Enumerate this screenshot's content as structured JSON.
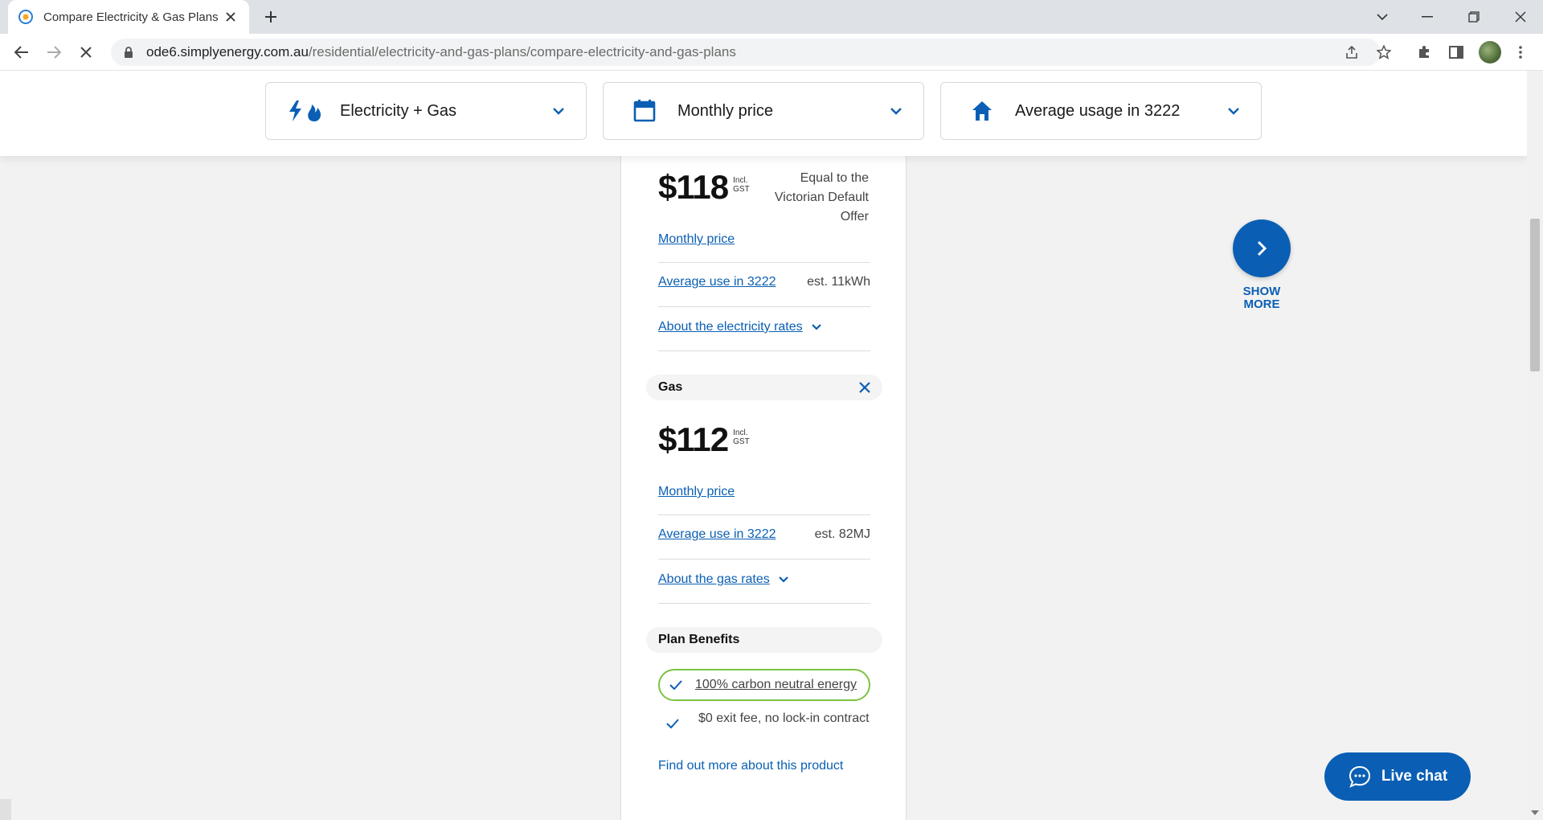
{
  "browser": {
    "tab_title": "Compare Electricity & Gas Plans |",
    "url_host": "ode6.simplyenergy.com.au",
    "url_path": "/residential/electricity-and-gas-plans/compare-electricity-and-gas-plans"
  },
  "filters": [
    {
      "label": "Electricity + Gas",
      "icon": "electricity-gas-icon"
    },
    {
      "label": "Monthly price",
      "icon": "calendar-icon"
    },
    {
      "label": "Average usage in 3222",
      "icon": "home-icon"
    }
  ],
  "electricity": {
    "price": "$118",
    "gst_line1": "Incl.",
    "gst_line2": "GST",
    "offer_note": "Equal to the Victorian Default Offer",
    "monthly_link": "Monthly price",
    "avg_link": "Average use in 3222",
    "est": "est. 11kWh",
    "about_link": "About the electricity rates"
  },
  "gas": {
    "section_label": "Gas",
    "price": "$112",
    "gst_line1": "Incl.",
    "gst_line2": "GST",
    "monthly_link": "Monthly price",
    "avg_link": "Average use in 3222",
    "est": "est. 82MJ",
    "about_link": "About the gas rates"
  },
  "benefits": {
    "section_label": "Plan Benefits",
    "items": [
      {
        "text": "100% carbon neutral energy",
        "is_link": true
      },
      {
        "text": "$0 exit fee, no lock-in contract",
        "is_link": false
      }
    ],
    "find_more": "Find out more about this product"
  },
  "show_more": {
    "line1": "SHOW",
    "line2": "MORE"
  },
  "live_chat": {
    "label": "Live chat"
  },
  "colors": {
    "brand_blue": "#0a5fb4",
    "benefit_highlight": "#7cc242"
  }
}
